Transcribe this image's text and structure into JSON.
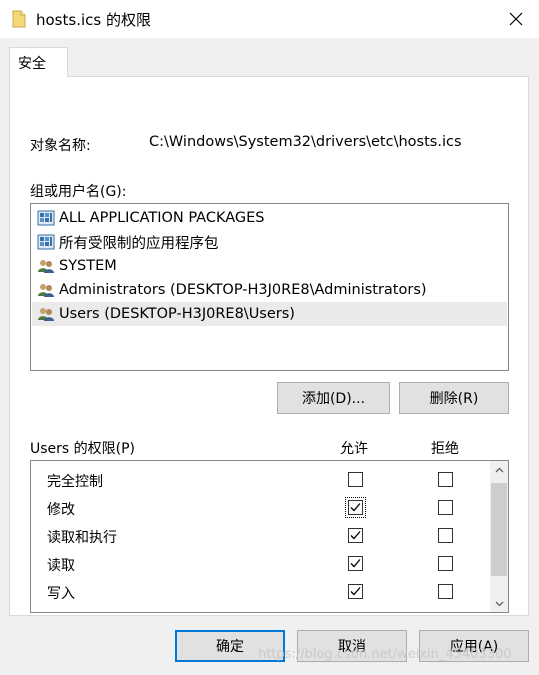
{
  "window": {
    "title": "hosts.ics 的权限",
    "tab_label": "安全"
  },
  "object": {
    "label": "对象名称:",
    "path": "C:\\Windows\\System32\\drivers\\etc\\hosts.ics"
  },
  "groups": {
    "label": "组或用户名(G):",
    "items": [
      {
        "name": "ALL APPLICATION PACKAGES",
        "icon": "app-package-icon"
      },
      {
        "name": "所有受限制的应用程序包",
        "icon": "app-package-icon"
      },
      {
        "name": "SYSTEM",
        "icon": "users-group-icon"
      },
      {
        "name": "Administrators (DESKTOP-H3J0RE8\\Administrators)",
        "icon": "users-group-icon"
      },
      {
        "name": "Users (DESKTOP-H3J0RE8\\Users)",
        "icon": "users-group-icon",
        "selected": true
      }
    ],
    "add_label": "添加(D)...",
    "remove_label": "删除(R)"
  },
  "permissions": {
    "label": "Users 的权限(P)",
    "allow_header": "允许",
    "deny_header": "拒绝",
    "rows": [
      {
        "name": "完全控制",
        "allow": false,
        "deny": false
      },
      {
        "name": "修改",
        "allow": true,
        "deny": false
      },
      {
        "name": "读取和执行",
        "allow": true,
        "deny": false
      },
      {
        "name": "读取",
        "allow": true,
        "deny": false
      },
      {
        "name": "写入",
        "allow": true,
        "deny": false
      }
    ]
  },
  "footer": {
    "ok_label": "确定",
    "cancel_label": "取消",
    "apply_label": "应用(A)"
  },
  "watermark": "https://blog.csdn.net/weixin_45403300",
  "colors": {
    "accent": "#0078d7",
    "selected_row": "#eaeaea",
    "dialog_bg": "#f0f0f0"
  }
}
